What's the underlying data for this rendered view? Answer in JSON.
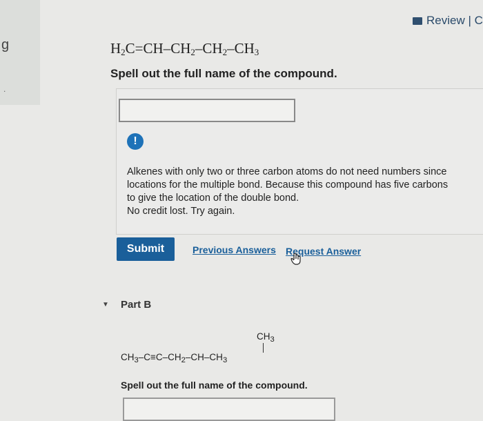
{
  "rail": {
    "char": "g",
    "dot": "."
  },
  "header": {
    "review_label": "Review | C"
  },
  "part_a": {
    "formula_parts": [
      "H",
      "2",
      "C=CH–CH",
      "2",
      "–CH",
      "2",
      "–CH",
      "3"
    ],
    "prompt": "Spell out the full name of the compound.",
    "input_value": "",
    "feedback_icon": "!",
    "feedback_lines": [
      "Alkenes with only two or three carbon atoms do not need numbers since",
      "locations for the multiple bond. Because this compound has five carbons",
      "to give the location of the double bond.",
      "No credit lost. Try again."
    ],
    "submit_label": "Submit",
    "previous_answers_label": "Previous Answers",
    "request_answer_label": "Request Answer"
  },
  "part_b": {
    "title": "Part B",
    "structure": {
      "top": [
        "CH",
        "3"
      ],
      "chain": [
        "CH",
        "3",
        "–C≡C–CH",
        "2",
        "–CH–CH",
        "3"
      ]
    },
    "prompt": "Spell out the full name of the compound.",
    "input_value": ""
  },
  "colors": {
    "accent": "#1a5f9a",
    "info": "#1e72b8"
  }
}
